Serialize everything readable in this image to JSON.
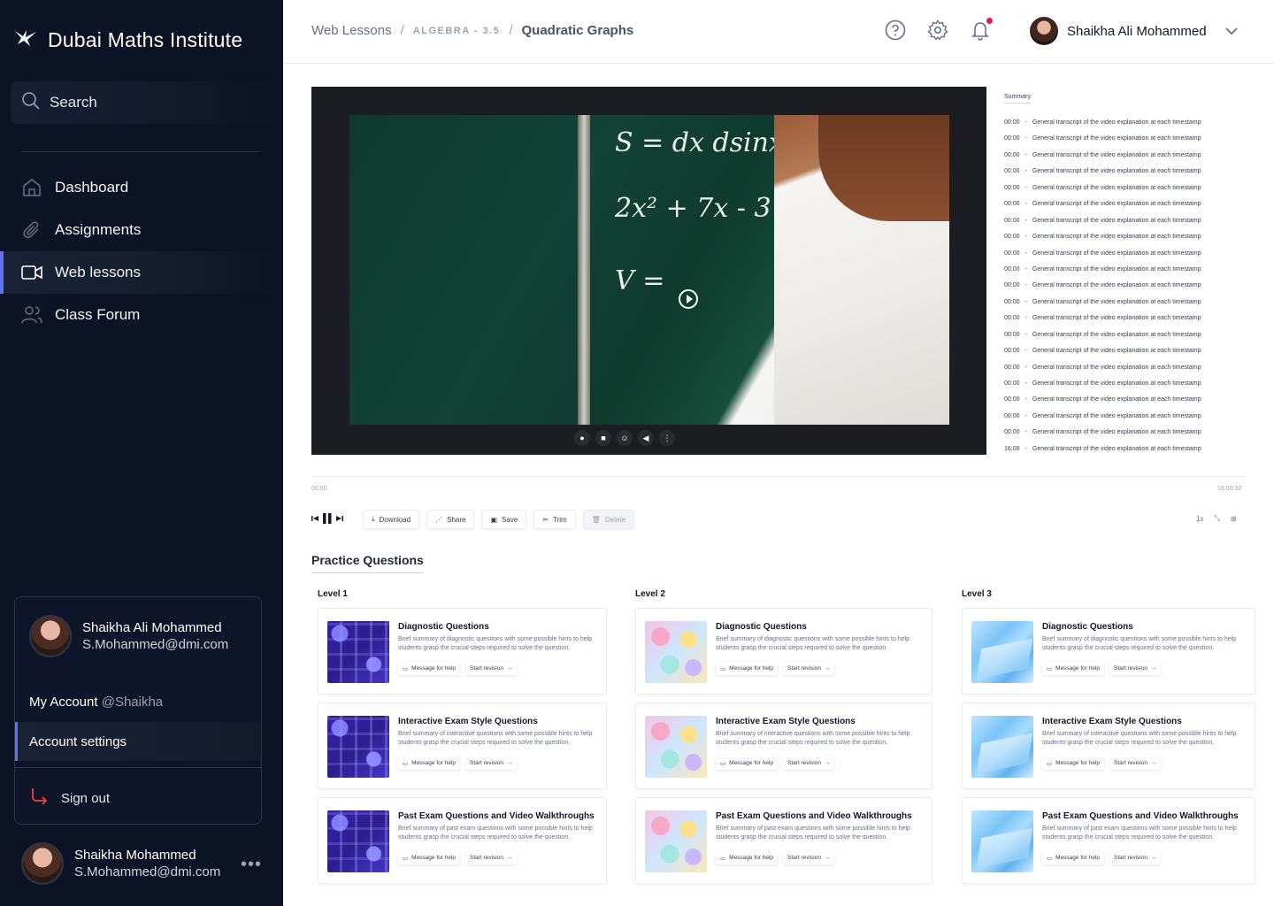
{
  "app": {
    "brand": "Dubai Maths Institute",
    "accent_color": "#6172f3",
    "sidebar_bg": "#0c1324"
  },
  "sidebar": {
    "search_placeholder": "Search",
    "items": [
      {
        "label": "Dashboard",
        "icon": "home-icon"
      },
      {
        "label": "Assignments",
        "icon": "paperclip-icon"
      },
      {
        "label": "Web lessons",
        "icon": "video-camera-icon",
        "active": true
      },
      {
        "label": "Class Forum",
        "icon": "users-icon"
      }
    ],
    "account": {
      "name": "Shaikha Ali Mohammed",
      "email": "S.Mohammed@dmi.com",
      "my_account": "My Account",
      "handle": "@Shaikha",
      "settings": "Account settings",
      "sign_out": "Sign out"
    },
    "bottom_user": {
      "name": "Shaikha Mohammed",
      "email": "S.Mohammed@dmi.com",
      "more": "•••"
    }
  },
  "header": {
    "breadcrumb": [
      "Web Lessons",
      "ALGEBRA - 3.5",
      "Quadratic Graphs"
    ],
    "separator": "/",
    "user_name": "Shaikha Ali Mohammed"
  },
  "video": {
    "chalk": [
      "S = dx dsinx",
      "2x² + 7x - 3 = 0",
      "V ="
    ]
  },
  "summary": {
    "title": "Summary",
    "rows": [
      {
        "time": "00:00",
        "text": "General transcript of the video explanation at each timestamp"
      },
      {
        "time": "00:00",
        "text": "General transcript of the video explanation at each timestamp"
      },
      {
        "time": "00:00",
        "text": "General transcript of the video explanation at each timestamp"
      },
      {
        "time": "00:00",
        "text": "General transcript of the video explanation at each timestamp"
      },
      {
        "time": "00:00",
        "text": "General transcript of the video explanation at each timestamp"
      },
      {
        "time": "00:00",
        "text": "General transcript of the video explanation at each timestamp"
      },
      {
        "time": "00:00",
        "text": "General transcript of the video explanation at each timestamp"
      },
      {
        "time": "00:00",
        "text": "General transcript of the video explanation at each timestamp"
      },
      {
        "time": "00:00",
        "text": "General transcript of the video explanation at each timestamp"
      },
      {
        "time": "00:00",
        "text": "General transcript of the video explanation at each timestamp"
      },
      {
        "time": "00:00",
        "text": "General transcript of the video explanation at each timestamp"
      },
      {
        "time": "00:00",
        "text": "General transcript of the video explanation at each timestamp"
      },
      {
        "time": "00:00",
        "text": "General transcript of the video explanation at each timestamp"
      },
      {
        "time": "00:00",
        "text": "General transcript of the video explanation at each timestamp"
      },
      {
        "time": "00:00",
        "text": "General transcript of the video explanation at each timestamp"
      },
      {
        "time": "00:00",
        "text": "General transcript of the video explanation at each timestamp"
      },
      {
        "time": "00:00",
        "text": "General transcript of the video explanation at each timestamp"
      },
      {
        "time": "00:00",
        "text": "General transcript of the video explanation at each timestamp"
      },
      {
        "time": "00:00",
        "text": "General transcript of the video explanation at each timestamp"
      },
      {
        "time": "00:00",
        "text": "General transcript of the video explanation at each timestamp"
      },
      {
        "time": "16:00",
        "text": "General transcript of the video explanation at each timestamp"
      }
    ]
  },
  "timeline": {
    "start": "00:00",
    "end": "16:00:32"
  },
  "toolbar": {
    "download": "Download",
    "share": "Share",
    "save": "Save",
    "trim": "Trim",
    "delete": "Delete",
    "speed": "1x"
  },
  "practice": {
    "title": "Practice Questions",
    "levels": [
      {
        "label": "Level 1",
        "cards": [
          {
            "title": "Diagnostic Questions",
            "desc": "Brief summary of diagnostic questions with some possible hints to help students grasp the crucial steps required to solve the question.",
            "help": "Message for help",
            "start": "Start revision"
          },
          {
            "title": "Interactive Exam Style Questions",
            "desc": "Brief summary of interactive questions with some possible hints to help students grasp the crucial steps required to solve the question.",
            "help": "Message for help",
            "start": "Start revision"
          },
          {
            "title": "Past Exam Questions and Video Walkthroughs",
            "desc": "Brief summary of past exam questions with some possible hints to help students grasp the crucial steps required to solve the question.",
            "help": "Message for help",
            "start": "Start revision"
          }
        ]
      },
      {
        "label": "Level 2",
        "cards": [
          {
            "title": "Diagnostic Questions",
            "desc": "Brief summary of diagnostic questions with some possible hints to help students grasp the crucial steps required to solve the question.",
            "help": "Message for help",
            "start": "Start revision"
          },
          {
            "title": "Interactive Exam Style Questions",
            "desc": "Brief summary of interactive questions with some possible hints to help students grasp the crucial steps required to solve the question.",
            "help": "Message for help",
            "start": "Start revision"
          },
          {
            "title": "Past Exam Questions and Video Walkthroughs",
            "desc": "Brief summary of past exam questions with some possible hints to help students grasp the crucial steps required to solve the question.",
            "help": "Message for help",
            "start": "Start revision"
          }
        ]
      },
      {
        "label": "Level 3",
        "cards": [
          {
            "title": "Diagnostic Questions",
            "desc": "Brief summary of diagnostic questions with some possible hints to help students grasp the crucial steps required to solve the question.",
            "help": "Message for help",
            "start": "Start revision"
          },
          {
            "title": "Interactive Exam Style Questions",
            "desc": "Brief summary of interactive questions with some possible hints to help students grasp the crucial steps required to solve the question.",
            "help": "Message for help",
            "start": "Start revision"
          },
          {
            "title": "Past Exam Questions and Video Walkthroughs",
            "desc": "Brief summary of past exam questions with some possible hints to help students grasp the crucial steps required to solve the question.",
            "help": "Message for help",
            "start": "Start revision"
          }
        ]
      }
    ]
  }
}
